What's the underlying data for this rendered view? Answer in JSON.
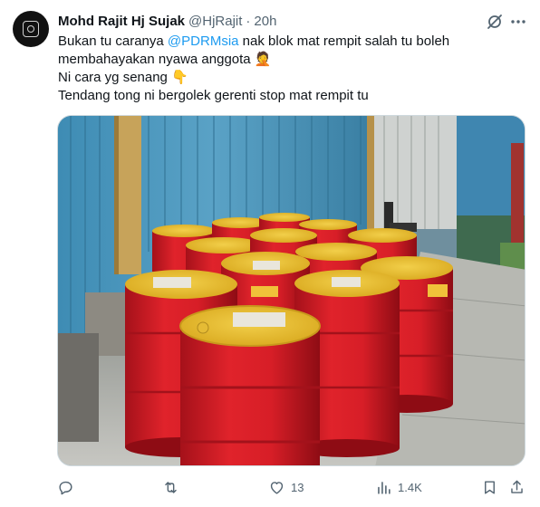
{
  "author": {
    "display_name": "Mohd Rajit Hj Sujak",
    "handle": "@HjRajit",
    "separator": "·",
    "time": "20h"
  },
  "tweet": {
    "line1_before": "Bukan tu caranya ",
    "mention": "@PDRMsia",
    "line1_after": " nak blok mat rempit salah tu boleh",
    "line2": "membahayakan nyawa anggota 🤦",
    "line3": "Ni cara yg senang 👇",
    "line4": "Tendang tong ni bergolek gerenti stop mat rempit tu"
  },
  "media": {
    "description_icon": "photo"
  },
  "actions": {
    "reply_count": "",
    "retweet_count": "",
    "like_count": "13",
    "views_count": "1.4K"
  },
  "colors": {
    "accent": "#1d9bf0",
    "secondary_text": "#536471",
    "primary_text": "#0f1419"
  }
}
